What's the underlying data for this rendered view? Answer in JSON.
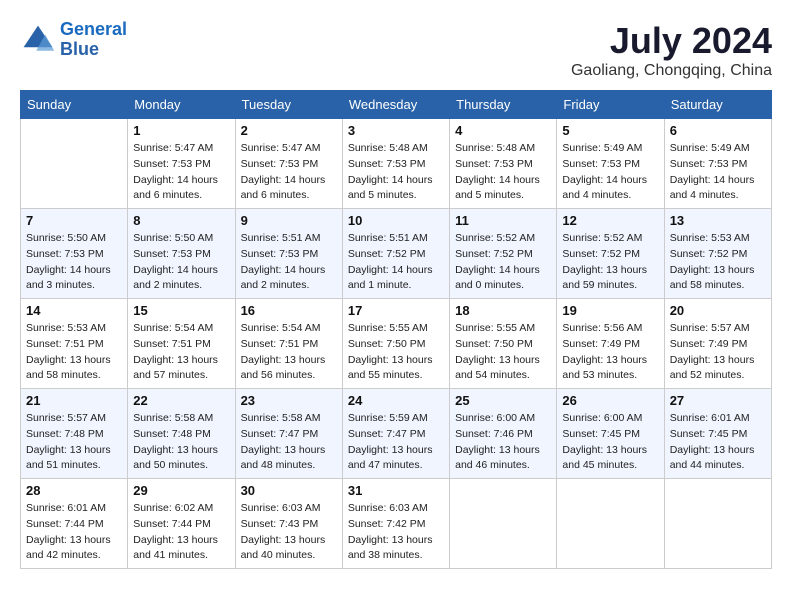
{
  "logo": {
    "line1": "General",
    "line2": "Blue"
  },
  "title": "July 2024",
  "subtitle": "Gaoliang, Chongqing, China",
  "weekdays": [
    "Sunday",
    "Monday",
    "Tuesday",
    "Wednesday",
    "Thursday",
    "Friday",
    "Saturday"
  ],
  "weeks": [
    [
      {
        "day": "",
        "info": ""
      },
      {
        "day": "1",
        "info": "Sunrise: 5:47 AM\nSunset: 7:53 PM\nDaylight: 14 hours\nand 6 minutes."
      },
      {
        "day": "2",
        "info": "Sunrise: 5:47 AM\nSunset: 7:53 PM\nDaylight: 14 hours\nand 6 minutes."
      },
      {
        "day": "3",
        "info": "Sunrise: 5:48 AM\nSunset: 7:53 PM\nDaylight: 14 hours\nand 5 minutes."
      },
      {
        "day": "4",
        "info": "Sunrise: 5:48 AM\nSunset: 7:53 PM\nDaylight: 14 hours\nand 5 minutes."
      },
      {
        "day": "5",
        "info": "Sunrise: 5:49 AM\nSunset: 7:53 PM\nDaylight: 14 hours\nand 4 minutes."
      },
      {
        "day": "6",
        "info": "Sunrise: 5:49 AM\nSunset: 7:53 PM\nDaylight: 14 hours\nand 4 minutes."
      }
    ],
    [
      {
        "day": "7",
        "info": "Sunrise: 5:50 AM\nSunset: 7:53 PM\nDaylight: 14 hours\nand 3 minutes."
      },
      {
        "day": "8",
        "info": "Sunrise: 5:50 AM\nSunset: 7:53 PM\nDaylight: 14 hours\nand 2 minutes."
      },
      {
        "day": "9",
        "info": "Sunrise: 5:51 AM\nSunset: 7:53 PM\nDaylight: 14 hours\nand 2 minutes."
      },
      {
        "day": "10",
        "info": "Sunrise: 5:51 AM\nSunset: 7:52 PM\nDaylight: 14 hours\nand 1 minute."
      },
      {
        "day": "11",
        "info": "Sunrise: 5:52 AM\nSunset: 7:52 PM\nDaylight: 14 hours\nand 0 minutes."
      },
      {
        "day": "12",
        "info": "Sunrise: 5:52 AM\nSunset: 7:52 PM\nDaylight: 13 hours\nand 59 minutes."
      },
      {
        "day": "13",
        "info": "Sunrise: 5:53 AM\nSunset: 7:52 PM\nDaylight: 13 hours\nand 58 minutes."
      }
    ],
    [
      {
        "day": "14",
        "info": "Sunrise: 5:53 AM\nSunset: 7:51 PM\nDaylight: 13 hours\nand 58 minutes."
      },
      {
        "day": "15",
        "info": "Sunrise: 5:54 AM\nSunset: 7:51 PM\nDaylight: 13 hours\nand 57 minutes."
      },
      {
        "day": "16",
        "info": "Sunrise: 5:54 AM\nSunset: 7:51 PM\nDaylight: 13 hours\nand 56 minutes."
      },
      {
        "day": "17",
        "info": "Sunrise: 5:55 AM\nSunset: 7:50 PM\nDaylight: 13 hours\nand 55 minutes."
      },
      {
        "day": "18",
        "info": "Sunrise: 5:55 AM\nSunset: 7:50 PM\nDaylight: 13 hours\nand 54 minutes."
      },
      {
        "day": "19",
        "info": "Sunrise: 5:56 AM\nSunset: 7:49 PM\nDaylight: 13 hours\nand 53 minutes."
      },
      {
        "day": "20",
        "info": "Sunrise: 5:57 AM\nSunset: 7:49 PM\nDaylight: 13 hours\nand 52 minutes."
      }
    ],
    [
      {
        "day": "21",
        "info": "Sunrise: 5:57 AM\nSunset: 7:48 PM\nDaylight: 13 hours\nand 51 minutes."
      },
      {
        "day": "22",
        "info": "Sunrise: 5:58 AM\nSunset: 7:48 PM\nDaylight: 13 hours\nand 50 minutes."
      },
      {
        "day": "23",
        "info": "Sunrise: 5:58 AM\nSunset: 7:47 PM\nDaylight: 13 hours\nand 48 minutes."
      },
      {
        "day": "24",
        "info": "Sunrise: 5:59 AM\nSunset: 7:47 PM\nDaylight: 13 hours\nand 47 minutes."
      },
      {
        "day": "25",
        "info": "Sunrise: 6:00 AM\nSunset: 7:46 PM\nDaylight: 13 hours\nand 46 minutes."
      },
      {
        "day": "26",
        "info": "Sunrise: 6:00 AM\nSunset: 7:45 PM\nDaylight: 13 hours\nand 45 minutes."
      },
      {
        "day": "27",
        "info": "Sunrise: 6:01 AM\nSunset: 7:45 PM\nDaylight: 13 hours\nand 44 minutes."
      }
    ],
    [
      {
        "day": "28",
        "info": "Sunrise: 6:01 AM\nSunset: 7:44 PM\nDaylight: 13 hours\nand 42 minutes."
      },
      {
        "day": "29",
        "info": "Sunrise: 6:02 AM\nSunset: 7:44 PM\nDaylight: 13 hours\nand 41 minutes."
      },
      {
        "day": "30",
        "info": "Sunrise: 6:03 AM\nSunset: 7:43 PM\nDaylight: 13 hours\nand 40 minutes."
      },
      {
        "day": "31",
        "info": "Sunrise: 6:03 AM\nSunset: 7:42 PM\nDaylight: 13 hours\nand 38 minutes."
      },
      {
        "day": "",
        "info": ""
      },
      {
        "day": "",
        "info": ""
      },
      {
        "day": "",
        "info": ""
      }
    ]
  ]
}
